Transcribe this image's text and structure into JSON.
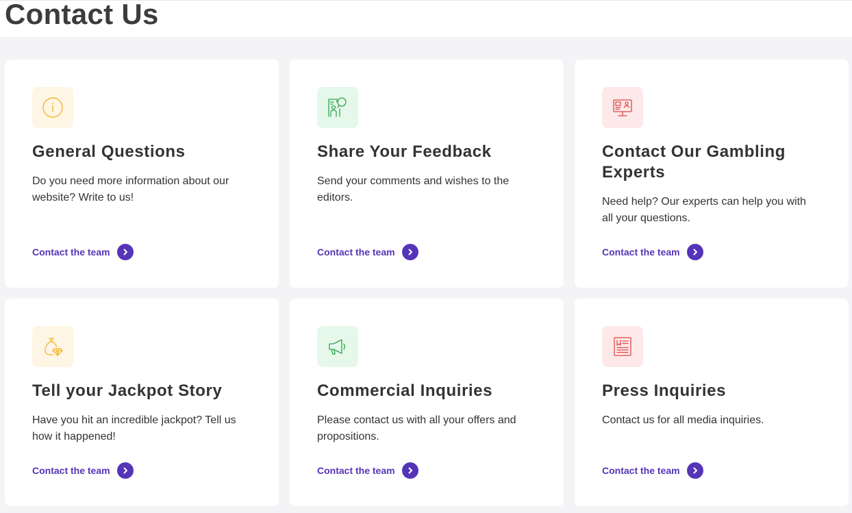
{
  "page": {
    "title": "Contact Us"
  },
  "colors": {
    "accent": "#5534b8",
    "yellow_bg": "#fff5e4",
    "yellow_icon": "#f2b630",
    "green_bg": "#e6f8ea",
    "green_icon": "#2ca44e",
    "red_bg": "#fde9e9",
    "red_icon": "#e04848"
  },
  "cards": [
    {
      "icon": "info-icon",
      "title": "General Questions",
      "description": "Do you need more information about our website? Write to us!",
      "cta": "Contact the team"
    },
    {
      "icon": "feedback-icon",
      "title": "Share Your Feedback",
      "description": "Send your comments and wishes to the editors.",
      "cta": "Contact the team"
    },
    {
      "icon": "expert-screen-icon",
      "title": "Contact Our Gambling Experts",
      "description": "Need help? Our experts can help you with all your questions.",
      "cta": "Contact the team"
    },
    {
      "icon": "money-bag-icon",
      "title": "Tell your Jackpot Story",
      "description": "Have you hit an incredible jackpot? Tell us how it happened!",
      "cta": "Contact the team"
    },
    {
      "icon": "megaphone-icon",
      "title": "Commercial Inquiries",
      "description": "Please contact us with all your offers and propositions.",
      "cta": "Contact the team"
    },
    {
      "icon": "newspaper-icon",
      "title": "Press Inquiries",
      "description": "Contact us for all media inquiries.",
      "cta": "Contact the team"
    }
  ]
}
